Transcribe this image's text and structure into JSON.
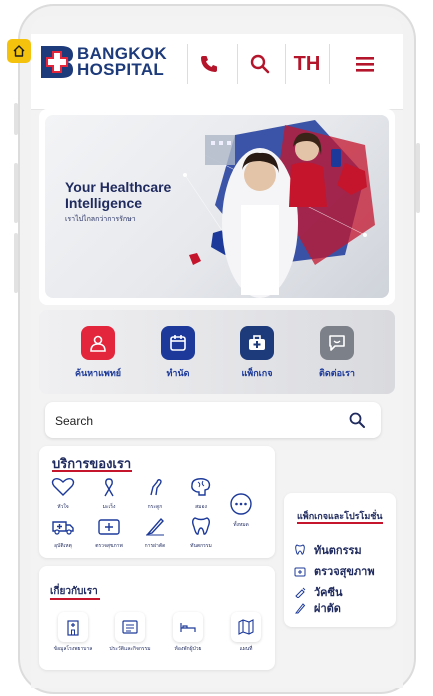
{
  "header": {
    "logo_line1": "BANGKOK",
    "logo_line2": "HOSPITAL",
    "phone_icon": "phone-icon",
    "search_icon": "search-icon",
    "language": "TH",
    "menu_icon": "hamburger-menu-icon"
  },
  "banner": {
    "title_line1": "Your Healthcare",
    "title_line2": "Intelligence",
    "subtitle": "เราไปไกลกว่าการรักษา"
  },
  "quick_actions": [
    {
      "label": "ค้นหาแพทย์",
      "icon": "doctor-icon",
      "color": "#e3263b"
    },
    {
      "label": "ทำนัด",
      "icon": "calendar-icon",
      "color": "#1d3a9a"
    },
    {
      "label": "แพ็กเกจ",
      "icon": "medical-bag-icon",
      "color": "#1d3a7a"
    },
    {
      "label": "ติดต่อเรา",
      "icon": "chat-icon",
      "color": "#7c8088"
    }
  ],
  "search": {
    "label": "Search"
  },
  "services": {
    "title": "บริการของเรา",
    "items": [
      {
        "label": "หัวใจ",
        "icon": "heart-icon"
      },
      {
        "label": "มะเร็ง",
        "icon": "ribbon-icon"
      },
      {
        "label": "กระดูก",
        "icon": "bone-icon"
      },
      {
        "label": "สมอง",
        "icon": "brain-icon"
      },
      {
        "label": "อุบัติเหตุ",
        "icon": "ambulance-icon"
      },
      {
        "label": "ตรวจสุขภาพ",
        "icon": "checkup-icon"
      },
      {
        "label": "การผ่าตัด",
        "icon": "scalpel-icon"
      },
      {
        "label": "ทันตกรรม",
        "icon": "tooth-icon"
      },
      {
        "label": "ทั้งหมด",
        "icon": "more-icon"
      }
    ]
  },
  "promotions": {
    "title": "แพ็กเกจและโปรโมชั่น",
    "items": [
      {
        "label": "ทันตกรรม",
        "icon": "tooth-icon"
      },
      {
        "label": "ตรวจสุขภาพ",
        "icon": "medical-kit-icon"
      },
      {
        "label": "วัคซีน",
        "icon": "syringe-icon"
      },
      {
        "label": "ผ่าตัด",
        "icon": "scalpel-icon"
      }
    ]
  },
  "about": {
    "title": "เกี่ยวกับเรา",
    "items": [
      {
        "label": "ข้อมูลโรงพยาบาล",
        "icon": "hospital-building-icon"
      },
      {
        "label": "ประวัติและกิจกรรม",
        "icon": "news-icon"
      },
      {
        "label": "ห้องพักผู้ป่วย",
        "icon": "bed-icon"
      },
      {
        "label": "แผนที่",
        "icon": "map-icon"
      }
    ]
  },
  "colors": {
    "brand_navy": "#1d3a7a",
    "brand_red": "#c4152d",
    "home_badge": "#f4c20d"
  }
}
